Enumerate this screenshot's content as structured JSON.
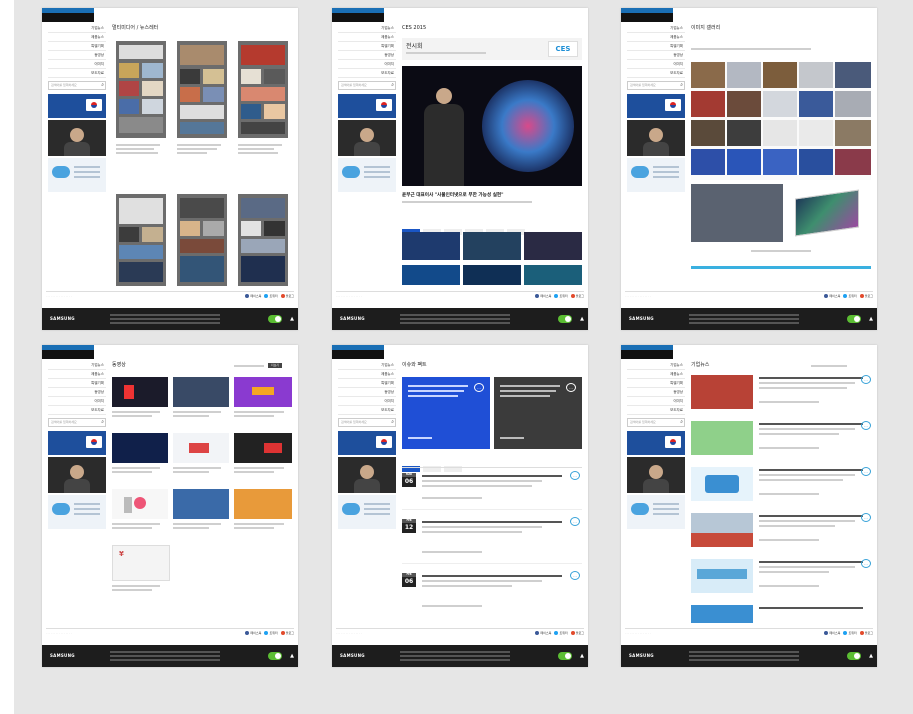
{
  "pages": [
    {
      "title": "멀티미디어 / 뉴스레터"
    },
    {
      "title": "CES 2015",
      "event_title": "전시회",
      "badge": "CES",
      "headline": "윤부근 대표이사 \"사물인터넷으로 무한 가능성 실현\""
    },
    {
      "title": "이미지 갤러리"
    },
    {
      "title": "동영상",
      "badge": "더보기"
    },
    {
      "title": "이슈와 팩트",
      "dates": [
        {
          "month": "MAR",
          "day": "06"
        },
        {
          "month": "FEB",
          "day": "12"
        },
        {
          "month": "FEB",
          "day": "06"
        }
      ]
    },
    {
      "title": "기업뉴스"
    }
  ],
  "sidebar": {
    "nav_items": [
      "기업뉴스",
      "제품뉴스",
      "특별기획",
      "동영상",
      "이미지",
      "보도자료"
    ],
    "search_placeholder": "검색어를 입력하세요",
    "search_icon": "search-icon"
  },
  "footer": {
    "brand": "SAMSUNG",
    "sns": [
      "페이스북",
      "트위터",
      "블로그"
    ],
    "up_label": "▲"
  },
  "colors": {
    "background": "#e6e6e6",
    "accent": "#1a56c5",
    "footer": "#1d1d1d",
    "toggle": "#5bbd33"
  }
}
